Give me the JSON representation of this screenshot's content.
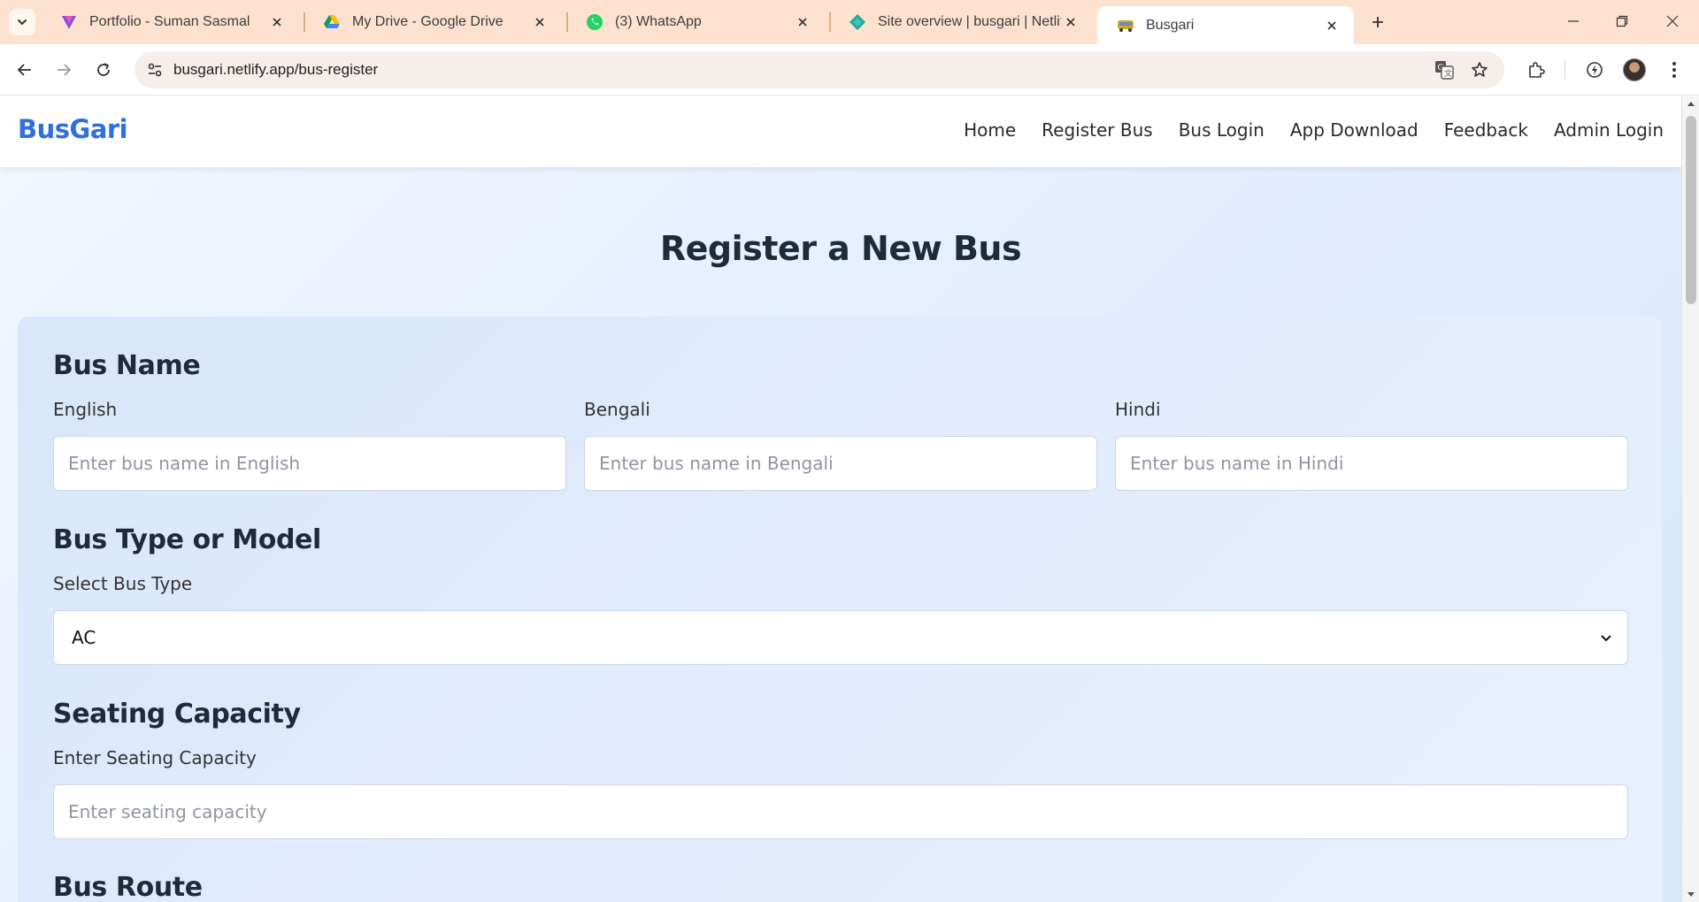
{
  "browser": {
    "tabs": [
      {
        "title": "Portfolio - Suman Sasmal",
        "icon": "v-logo-icon"
      },
      {
        "title": "My Drive - Google Drive",
        "icon": "google-drive-icon"
      },
      {
        "title": "(3) WhatsApp",
        "icon": "whatsapp-icon"
      },
      {
        "title": "Site overview | busgari | Netlify",
        "icon": "netlify-icon"
      },
      {
        "title": "Busgari",
        "icon": "bus-icon",
        "active": true
      }
    ],
    "url": "busgari.netlify.app/bus-register"
  },
  "site": {
    "brand": "BusGari",
    "nav": [
      "Home",
      "Register Bus",
      "Bus Login",
      "App Download",
      "Feedback",
      "Admin Login"
    ]
  },
  "page": {
    "title": "Register a New Bus",
    "sections": {
      "bus_name": {
        "heading": "Bus Name",
        "fields": [
          {
            "label": "English",
            "placeholder": "Enter bus name in English"
          },
          {
            "label": "Bengali",
            "placeholder": "Enter bus name in Bengali"
          },
          {
            "label": "Hindi",
            "placeholder": "Enter bus name in Hindi"
          }
        ]
      },
      "bus_type": {
        "heading": "Bus Type or Model",
        "label": "Select Bus Type",
        "selected": "AC"
      },
      "seating": {
        "heading": "Seating Capacity",
        "label": "Enter Seating Capacity",
        "placeholder": "Enter seating capacity"
      },
      "route": {
        "heading": "Bus Route"
      }
    }
  },
  "colors": {
    "brand": "#2f6fe0",
    "tabstrip": "#fde3cf",
    "page_bg": "#e3edfd",
    "card_bg": "#dfe9fc"
  }
}
